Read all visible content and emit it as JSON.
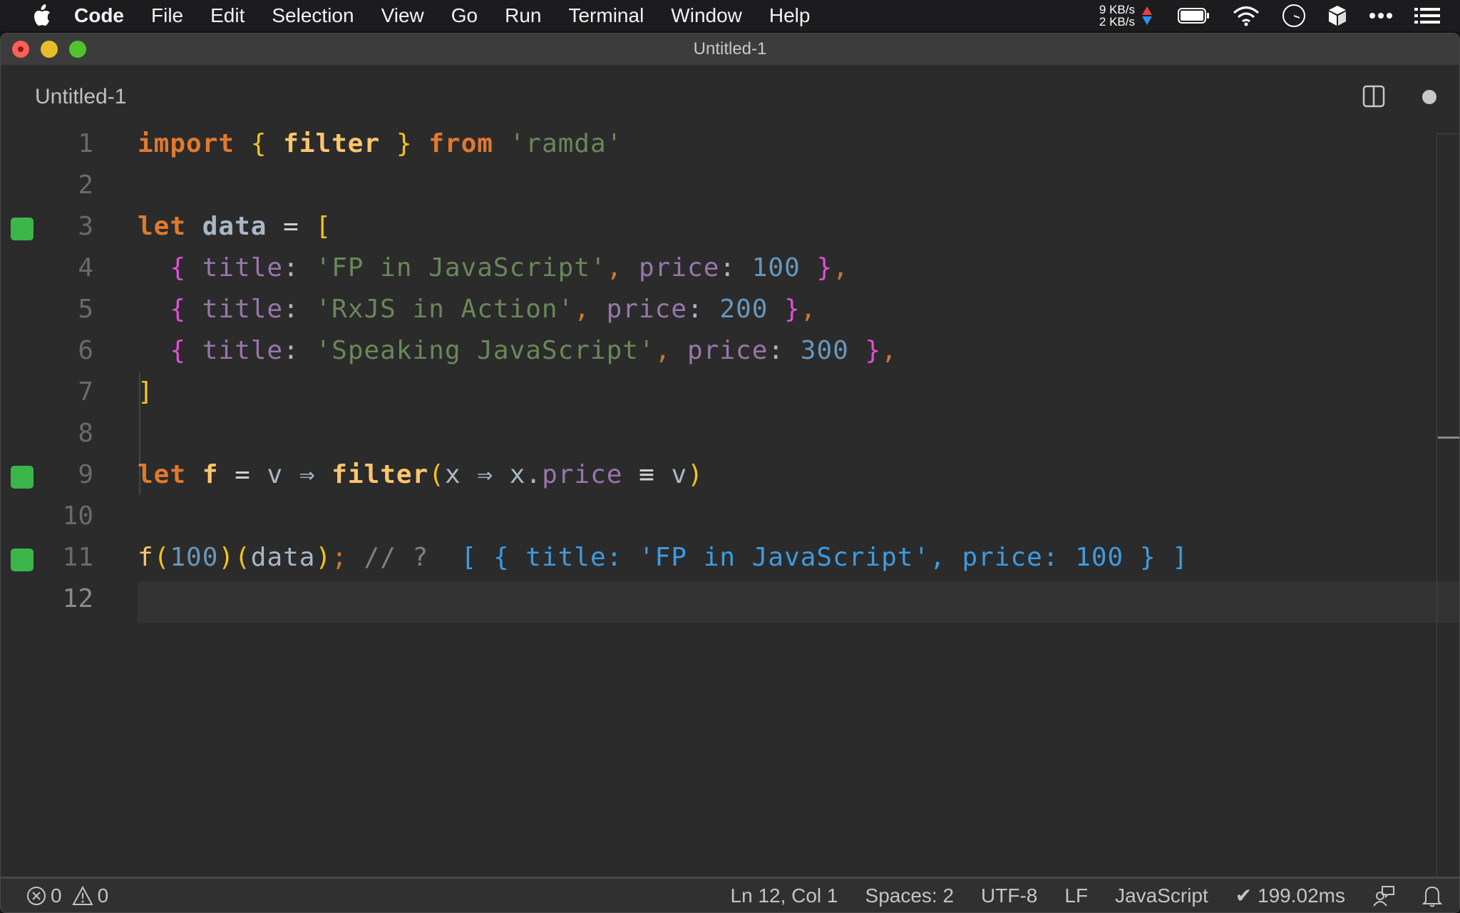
{
  "menubar": {
    "app_name": "Code",
    "items": [
      "File",
      "Edit",
      "Selection",
      "View",
      "Go",
      "Run",
      "Terminal",
      "Window",
      "Help"
    ],
    "net_up": "9 KB/s",
    "net_down": "2 KB/s",
    "icons": [
      "battery-icon",
      "wifi-icon",
      "clock-icon",
      "box-icon",
      "more-icon",
      "list-icon"
    ]
  },
  "window": {
    "title": "Untitled-1"
  },
  "tab": {
    "label": "Untitled-1"
  },
  "editor": {
    "lines": [
      {
        "number": "1",
        "marked": false
      },
      {
        "number": "2",
        "marked": false
      },
      {
        "number": "3",
        "marked": true
      },
      {
        "number": "4",
        "marked": false
      },
      {
        "number": "5",
        "marked": false
      },
      {
        "number": "6",
        "marked": false
      },
      {
        "number": "7",
        "marked": false
      },
      {
        "number": "8",
        "marked": false
      },
      {
        "number": "9",
        "marked": true
      },
      {
        "number": "10",
        "marked": false
      },
      {
        "number": "11",
        "marked": true
      },
      {
        "number": "12",
        "marked": false
      }
    ],
    "code": {
      "l1": {
        "import": "import",
        "lbrace": "{",
        "filter": "filter",
        "rbrace": "}",
        "from": "from",
        "module": "'ramda'"
      },
      "l3": {
        "let": "let",
        "name": "data",
        "eq": "=",
        "lbracket": "["
      },
      "l4": {
        "title_key": "title",
        "title_val": "'FP in JavaScript'",
        "price_key": "price",
        "price_val": "100"
      },
      "l5": {
        "title_key": "title",
        "title_val": "'RxJS in Action'",
        "price_key": "price",
        "price_val": "200"
      },
      "l6": {
        "title_key": "title",
        "title_val": "'Speaking JavaScript'",
        "price_key": "price",
        "price_val": "300"
      },
      "l7": {
        "rbracket": "]"
      },
      "l9": {
        "let": "let",
        "name": "f",
        "eq": "=",
        "param": "v",
        "arrow": "⇒",
        "call": "filter",
        "x": "x",
        "arrow2": "⇒",
        "obj": "x",
        "prop": "price",
        "op": "≡",
        "v": "v"
      },
      "l11": {
        "fn": "f",
        "arg1": "100",
        "arg2": "data",
        "comment": "// ?",
        "result": "[ { title: 'FP in JavaScript', price: 100 } ]"
      }
    }
  },
  "statusbar": {
    "errors": "0",
    "warnings": "0",
    "position": "Ln 12, Col 1",
    "indent": "Spaces: 2",
    "encoding": "UTF-8",
    "eol": "LF",
    "language": "JavaScript",
    "timing": "✔ 199.02ms"
  }
}
